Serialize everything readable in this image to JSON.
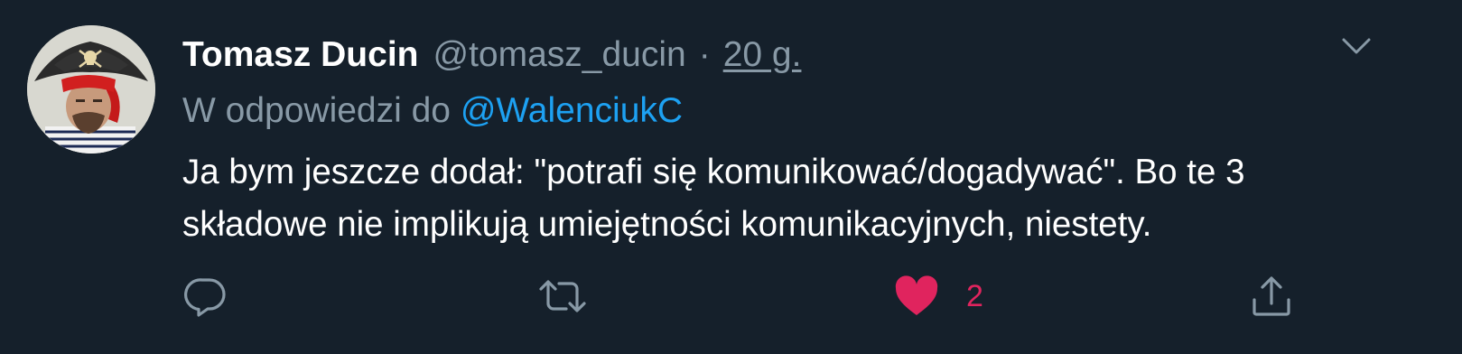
{
  "tweet": {
    "author_name": "Tomasz Ducin",
    "author_handle": "@tomasz_ducin",
    "separator": "·",
    "timestamp": "20 g.",
    "reply_prefix": "W odpowiedzi do",
    "reply_mention": "@WalenciukC",
    "text_lines": [
      "Ja bym jeszcze dodał: \"potrafi się komunikować/dogadywać\". Bo te 3",
      "składowe nie implikują umiejętności komunikacyjnych, niestety."
    ],
    "like_count": "2"
  },
  "actions": {
    "reply_icon": "reply-icon",
    "retweet_icon": "retweet-icon",
    "like_icon": "heart-icon",
    "share_icon": "share-icon"
  },
  "colors": {
    "background": "#15202b",
    "primary_text": "#ffffff",
    "secondary_text": "#8899a6",
    "link": "#1da1f2",
    "liked": "#e0245e"
  }
}
